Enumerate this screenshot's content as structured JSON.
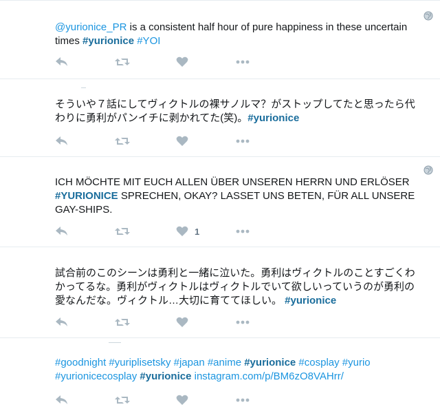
{
  "timeline": {
    "tweets": [
      {
        "segments": [
          {
            "type": "mention",
            "text": "@yurionice_PR"
          },
          {
            "type": "text",
            "text": " is a consistent half hour of pure happiness in these uncertain times "
          },
          {
            "type": "hashtag",
            "text": "#yurionice"
          },
          {
            "type": "text",
            "text": " "
          },
          {
            "type": "link",
            "text": "#YOI"
          }
        ],
        "has_globe": true,
        "like_count": ""
      },
      {
        "segments": [
          {
            "type": "text",
            "text": "そういや７話にしてヴィクトルの裸サノルマ？がストップしてたと思ったら代わりに勇利がパンイチに剥かれてた(笑)。"
          },
          {
            "type": "hashtag",
            "text": "#yurionice"
          }
        ],
        "has_globe": false,
        "like_count": ""
      },
      {
        "segments": [
          {
            "type": "text",
            "text": "ICH MÖCHTE MIT EUCH ALLEN ÜBER UNSEREN HERRN UND ERLÖSER "
          },
          {
            "type": "hashtag",
            "text": "#YURIONICE"
          },
          {
            "type": "text",
            "text": " SPRECHEN, OKAY? LASSET UNS BETEN, FÜR ALL UNSERE GAY-SHIPS."
          }
        ],
        "has_globe": true,
        "like_count": "1"
      },
      {
        "segments": [
          {
            "type": "text",
            "text": "試合前のこのシーンは勇利と一緒に泣いた。勇利はヴィクトルのことすごくわかってるな。勇利がヴィクトルはヴィクトルでいて欲しいっていうのが勇利の愛なんだな。ヴィクトル…大切に育ててほしい。 "
          },
          {
            "type": "hashtag",
            "text": "#yurionice"
          }
        ],
        "has_globe": false,
        "like_count": ""
      },
      {
        "segments": [
          {
            "type": "link",
            "text": "#goodnight"
          },
          {
            "type": "text",
            "text": " "
          },
          {
            "type": "link",
            "text": "#yuriplisetsky"
          },
          {
            "type": "text",
            "text": " "
          },
          {
            "type": "link",
            "text": "#japan"
          },
          {
            "type": "text",
            "text": " "
          },
          {
            "type": "link",
            "text": "#anime"
          },
          {
            "type": "text",
            "text": " "
          },
          {
            "type": "hashtag",
            "text": "#yurionice"
          },
          {
            "type": "text",
            "text": " "
          },
          {
            "type": "link",
            "text": "#cosplay"
          },
          {
            "type": "text",
            "text": " "
          },
          {
            "type": "link",
            "text": "#yurio"
          },
          {
            "type": "text",
            "text": " "
          },
          {
            "type": "link",
            "text": "#yurionicecosplay"
          },
          {
            "type": "text",
            "text": " "
          },
          {
            "type": "hashtag",
            "text": "#yurionice"
          },
          {
            "type": "text",
            "text": " "
          },
          {
            "type": "url",
            "text": "instagram.com/p/BM6zO8VAHrr/"
          }
        ],
        "has_globe": false,
        "like_count": ""
      }
    ]
  },
  "icons": {
    "reply": "reply-icon",
    "retweet": "retweet-icon",
    "like": "heart-icon",
    "more": "more-icon",
    "globe": "globe-icon"
  },
  "colors": {
    "link": "#1b95e0",
    "hashtag_strong": "#1a6d9c",
    "icon": "#aab8c2",
    "text": "#14171a",
    "divider": "#e6ecf0"
  }
}
